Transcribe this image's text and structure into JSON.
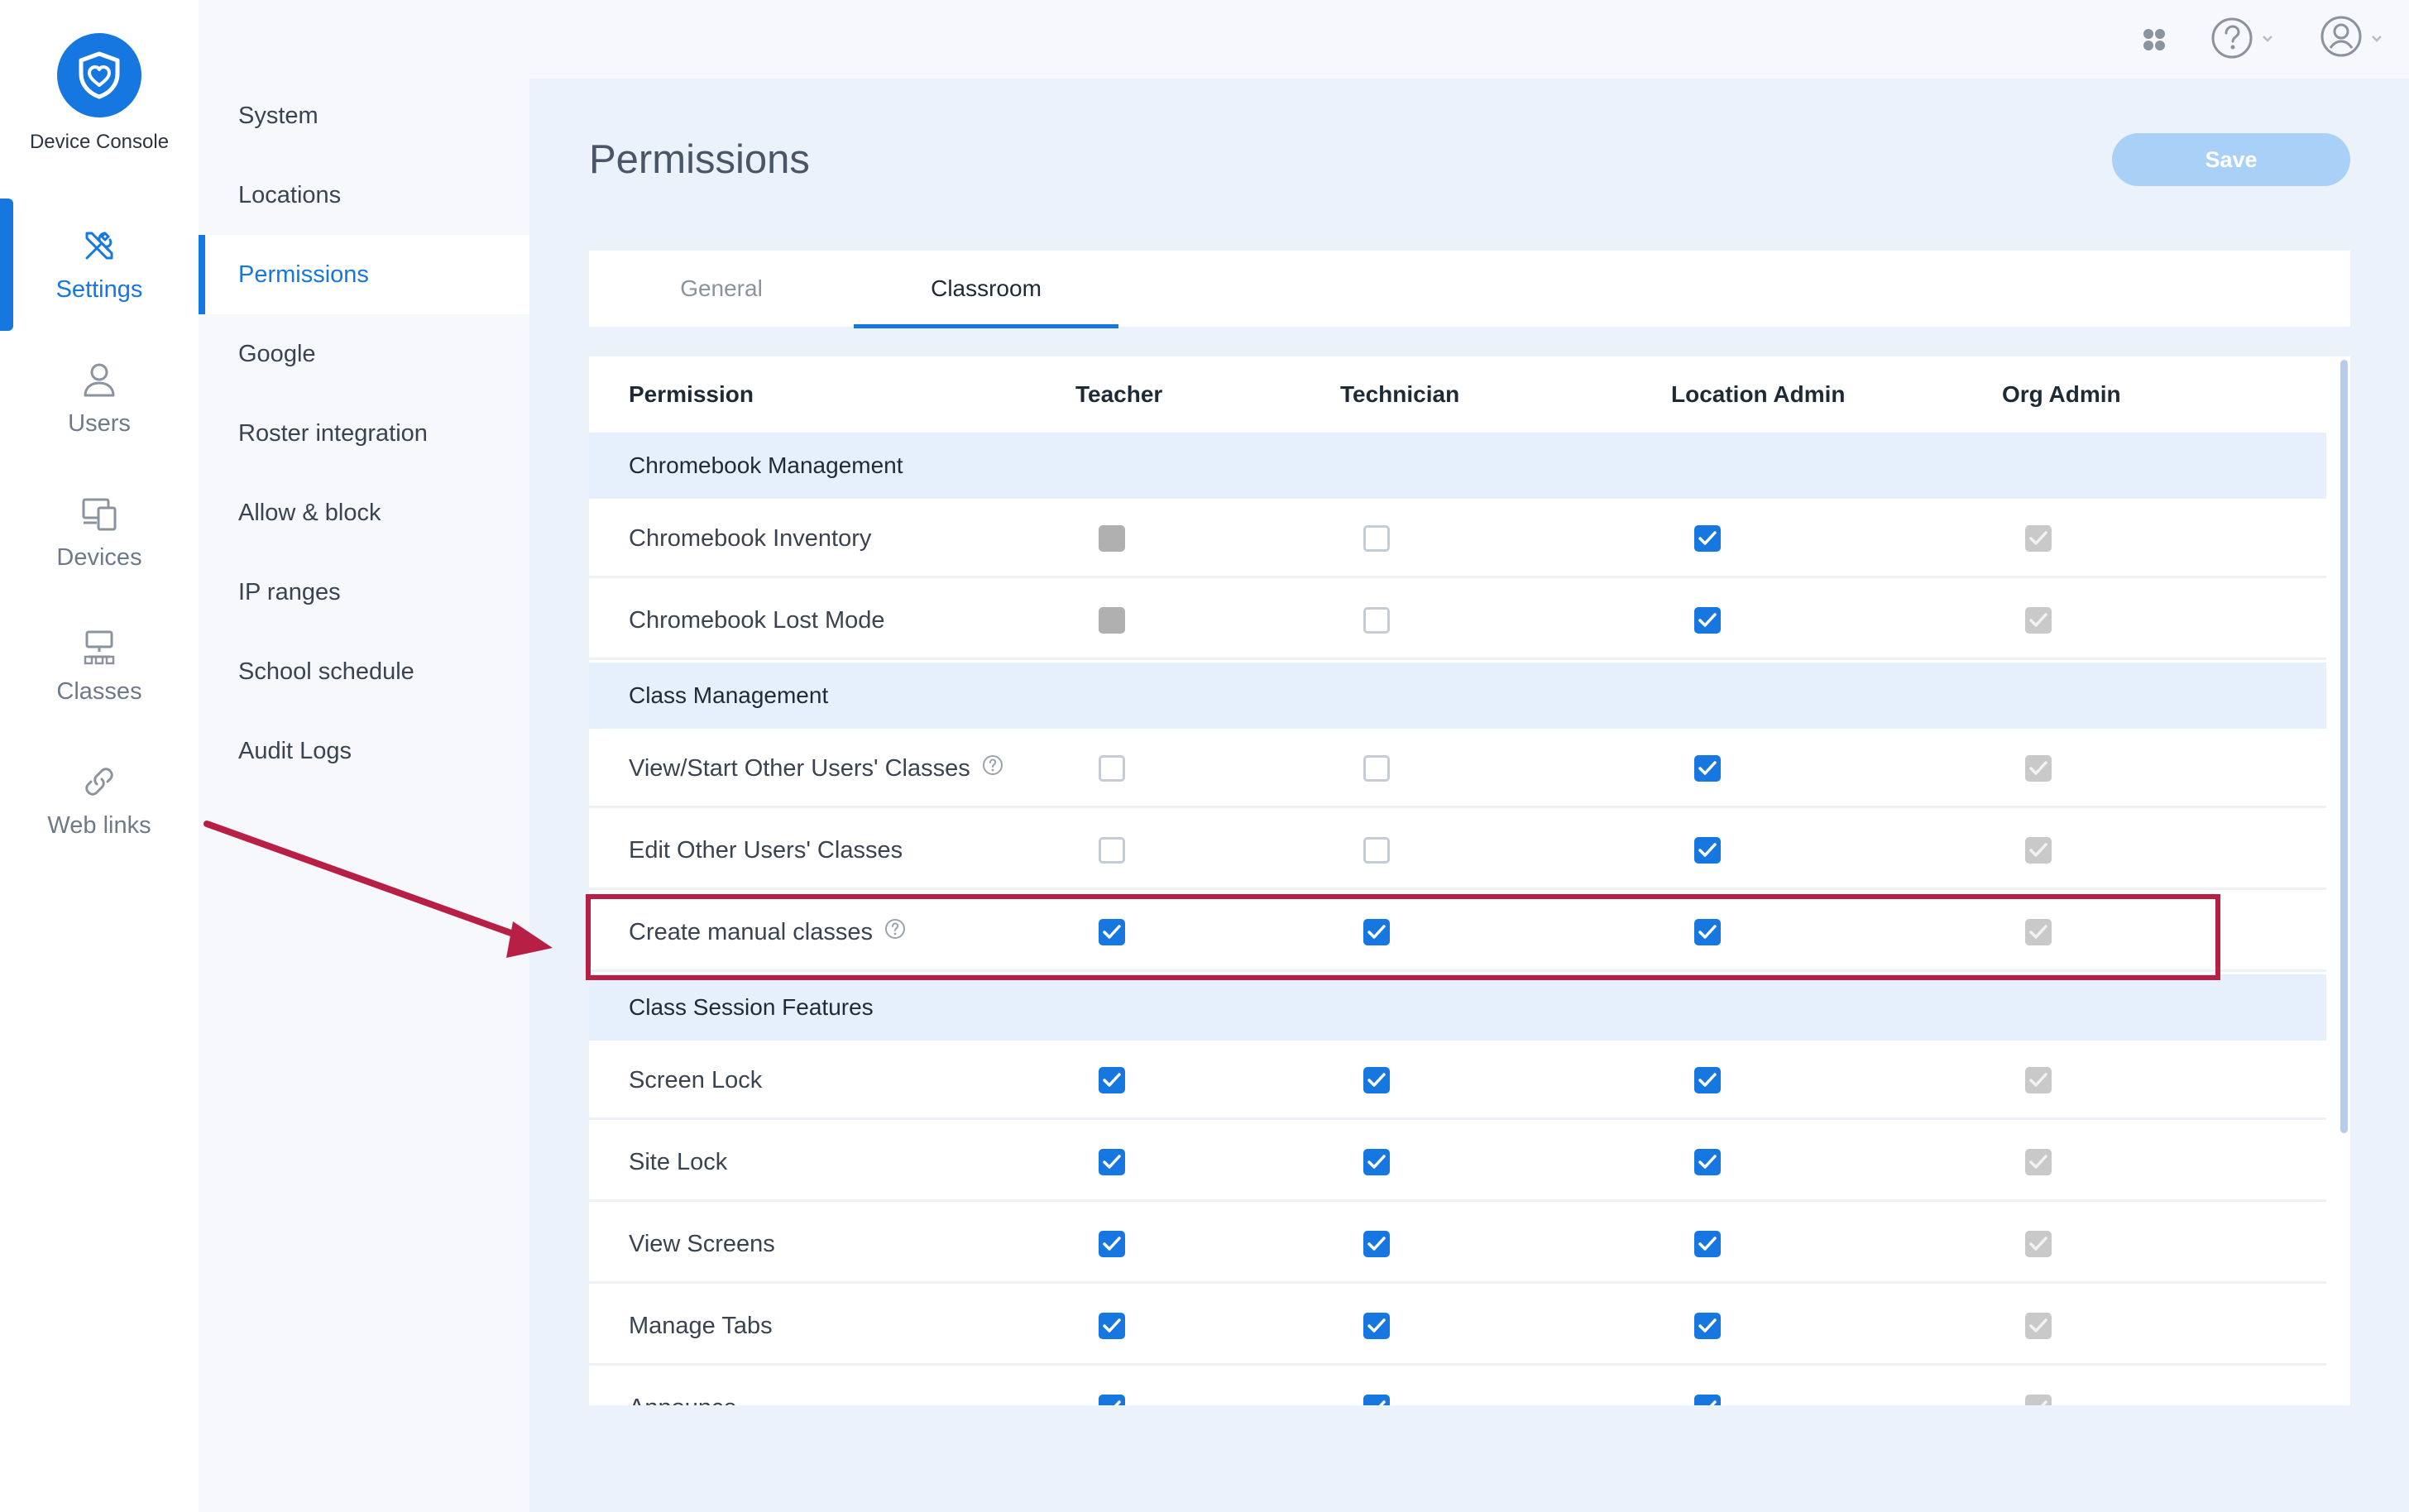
{
  "app": {
    "name": "Device Console"
  },
  "rail": {
    "items": [
      {
        "label": "Settings",
        "icon": "wrench-screwdriver-icon",
        "active": true
      },
      {
        "label": "Users",
        "icon": "user-icon",
        "active": false
      },
      {
        "label": "Devices",
        "icon": "devices-icon",
        "active": false
      },
      {
        "label": "Classes",
        "icon": "classes-icon",
        "active": false
      },
      {
        "label": "Web links",
        "icon": "link-icon",
        "active": false
      }
    ]
  },
  "subnav": {
    "items": [
      {
        "label": "System",
        "active": false
      },
      {
        "label": "Locations",
        "active": false
      },
      {
        "label": "Permissions",
        "active": true
      },
      {
        "label": "Google",
        "active": false
      },
      {
        "label": "Roster integration",
        "active": false
      },
      {
        "label": "Allow & block",
        "active": false
      },
      {
        "label": "IP ranges",
        "active": false
      },
      {
        "label": "School schedule",
        "active": false
      },
      {
        "label": "Audit Logs",
        "active": false
      }
    ]
  },
  "topbar": {
    "icons": [
      "apps-grid-icon",
      "help-circle-icon",
      "account-icon"
    ]
  },
  "page": {
    "title": "Permissions",
    "save_label": "Save"
  },
  "tabs": [
    {
      "label": "General",
      "active": false
    },
    {
      "label": "Classroom",
      "active": true
    }
  ],
  "table": {
    "columns": [
      "Permission",
      "Teacher",
      "Technician",
      "Location Admin",
      "Org Admin"
    ],
    "sections": [
      {
        "title": "Chromebook Management",
        "rows": [
          {
            "label": "Chromebook Inventory",
            "help": false,
            "values": [
              "disabled",
              "off",
              "on",
              "locked"
            ]
          },
          {
            "label": "Chromebook Lost Mode",
            "help": false,
            "values": [
              "disabled",
              "off",
              "on",
              "locked"
            ]
          }
        ]
      },
      {
        "title": "Class Management",
        "rows": [
          {
            "label": "View/Start Other Users' Classes",
            "help": true,
            "values": [
              "off",
              "off",
              "on",
              "locked"
            ]
          },
          {
            "label": "Edit Other Users' Classes",
            "help": false,
            "values": [
              "off",
              "off",
              "on",
              "locked"
            ]
          },
          {
            "label": "Create manual classes",
            "help": true,
            "values": [
              "on",
              "on",
              "on",
              "locked"
            ]
          }
        ]
      },
      {
        "title": "Class Session Features",
        "rows": [
          {
            "label": "Screen Lock",
            "help": false,
            "values": [
              "on",
              "on",
              "on",
              "locked"
            ]
          },
          {
            "label": "Site Lock",
            "help": false,
            "values": [
              "on",
              "on",
              "on",
              "locked"
            ]
          },
          {
            "label": "View Screens",
            "help": false,
            "values": [
              "on",
              "on",
              "on",
              "locked"
            ]
          },
          {
            "label": "Manage Tabs",
            "help": false,
            "values": [
              "on",
              "on",
              "on",
              "locked"
            ]
          },
          {
            "label": "Announce",
            "help": false,
            "values": [
              "on",
              "on",
              "on",
              "locked"
            ]
          }
        ]
      }
    ]
  },
  "colors": {
    "accent": "#1777e0",
    "annotation": "#b81f45",
    "section_bg": "#e6f0fd",
    "save_disabled": "#a9d0f7"
  }
}
